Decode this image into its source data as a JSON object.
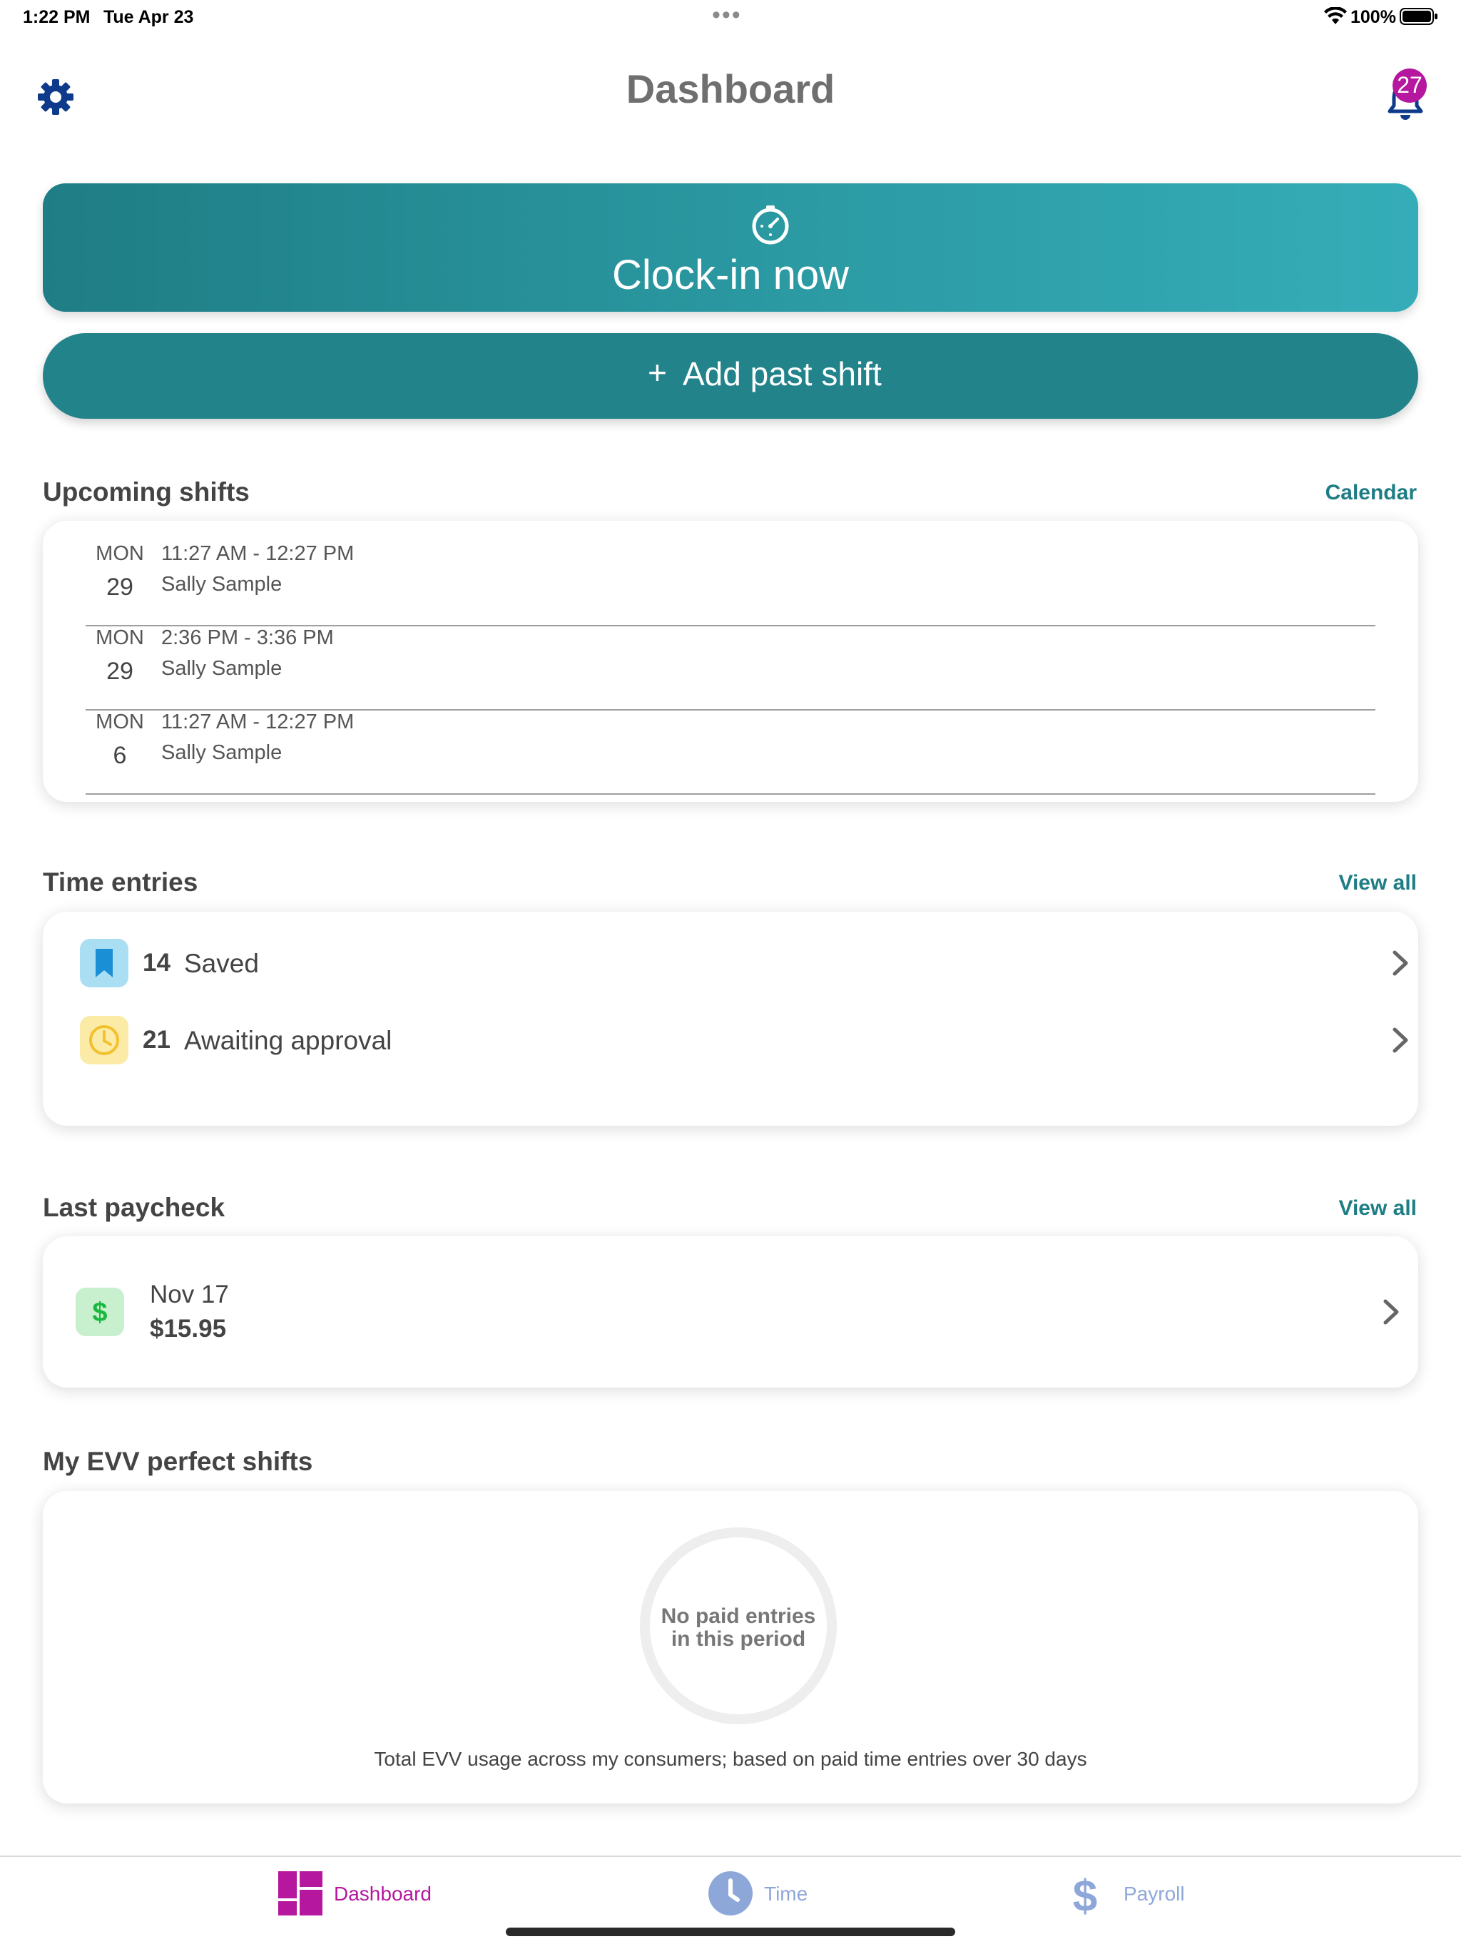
{
  "status_bar": {
    "time": "1:22 PM",
    "date": "Tue Apr 23",
    "battery": "100%"
  },
  "header": {
    "title": "Dashboard",
    "notification_count": "27",
    "settings_icon": "gear-icon",
    "notification_icon": "bell-icon"
  },
  "actions": {
    "clock_in_label": "Clock-in now",
    "clock_in_icon": "stopwatch-icon",
    "add_shift_plus": "+",
    "add_shift_label": "Add past shift"
  },
  "upcoming": {
    "title": "Upcoming shifts",
    "link": "Calendar",
    "shifts": [
      {
        "dow": "MON",
        "day": "29",
        "time": "11:27 AM - 12:27 PM",
        "name": "Sally Sample"
      },
      {
        "dow": "MON",
        "day": "29",
        "time": "2:36 PM - 3:36 PM",
        "name": "Sally Sample"
      },
      {
        "dow": "MON",
        "day": "6",
        "time": "11:27 AM - 12:27 PM",
        "name": "Sally Sample"
      }
    ]
  },
  "time_entries": {
    "title": "Time entries",
    "link": "View all",
    "items": [
      {
        "count": "14",
        "label": "Saved",
        "icon": "bookmark-icon",
        "icon_bg": "#a9def3",
        "icon_color": "#1b8fd6"
      },
      {
        "count": "21",
        "label": "Awaiting approval",
        "icon": "clock-icon",
        "icon_bg": "#fbeba6",
        "icon_color": "#f2c12e"
      }
    ]
  },
  "paycheck": {
    "title": "Last paycheck",
    "link": "View all",
    "date": "Nov 17",
    "amount": "$15.95",
    "icon": "dollar-icon",
    "icon_color": "#19b83e"
  },
  "evv": {
    "title": "My EVV perfect shifts",
    "empty_line1": "No paid entries",
    "empty_line2": "in this period",
    "note": "Total EVV usage across my consumers; based on paid time entries over 30 days"
  },
  "tabs": [
    {
      "label": "Dashboard",
      "icon": "dashboard-grid-icon",
      "active": true,
      "color": "#b5179e"
    },
    {
      "label": "Time",
      "icon": "clock-icon",
      "active": false,
      "color": "#8ea7d9"
    },
    {
      "label": "Payroll",
      "icon": "dollar-icon",
      "active": false,
      "color": "#8ea7d9"
    }
  ],
  "colors": {
    "primary_teal": "#22838b",
    "link_teal": "#1f7d85",
    "badge_magenta": "#b5179e",
    "navy_icon": "#0d3a8a"
  }
}
